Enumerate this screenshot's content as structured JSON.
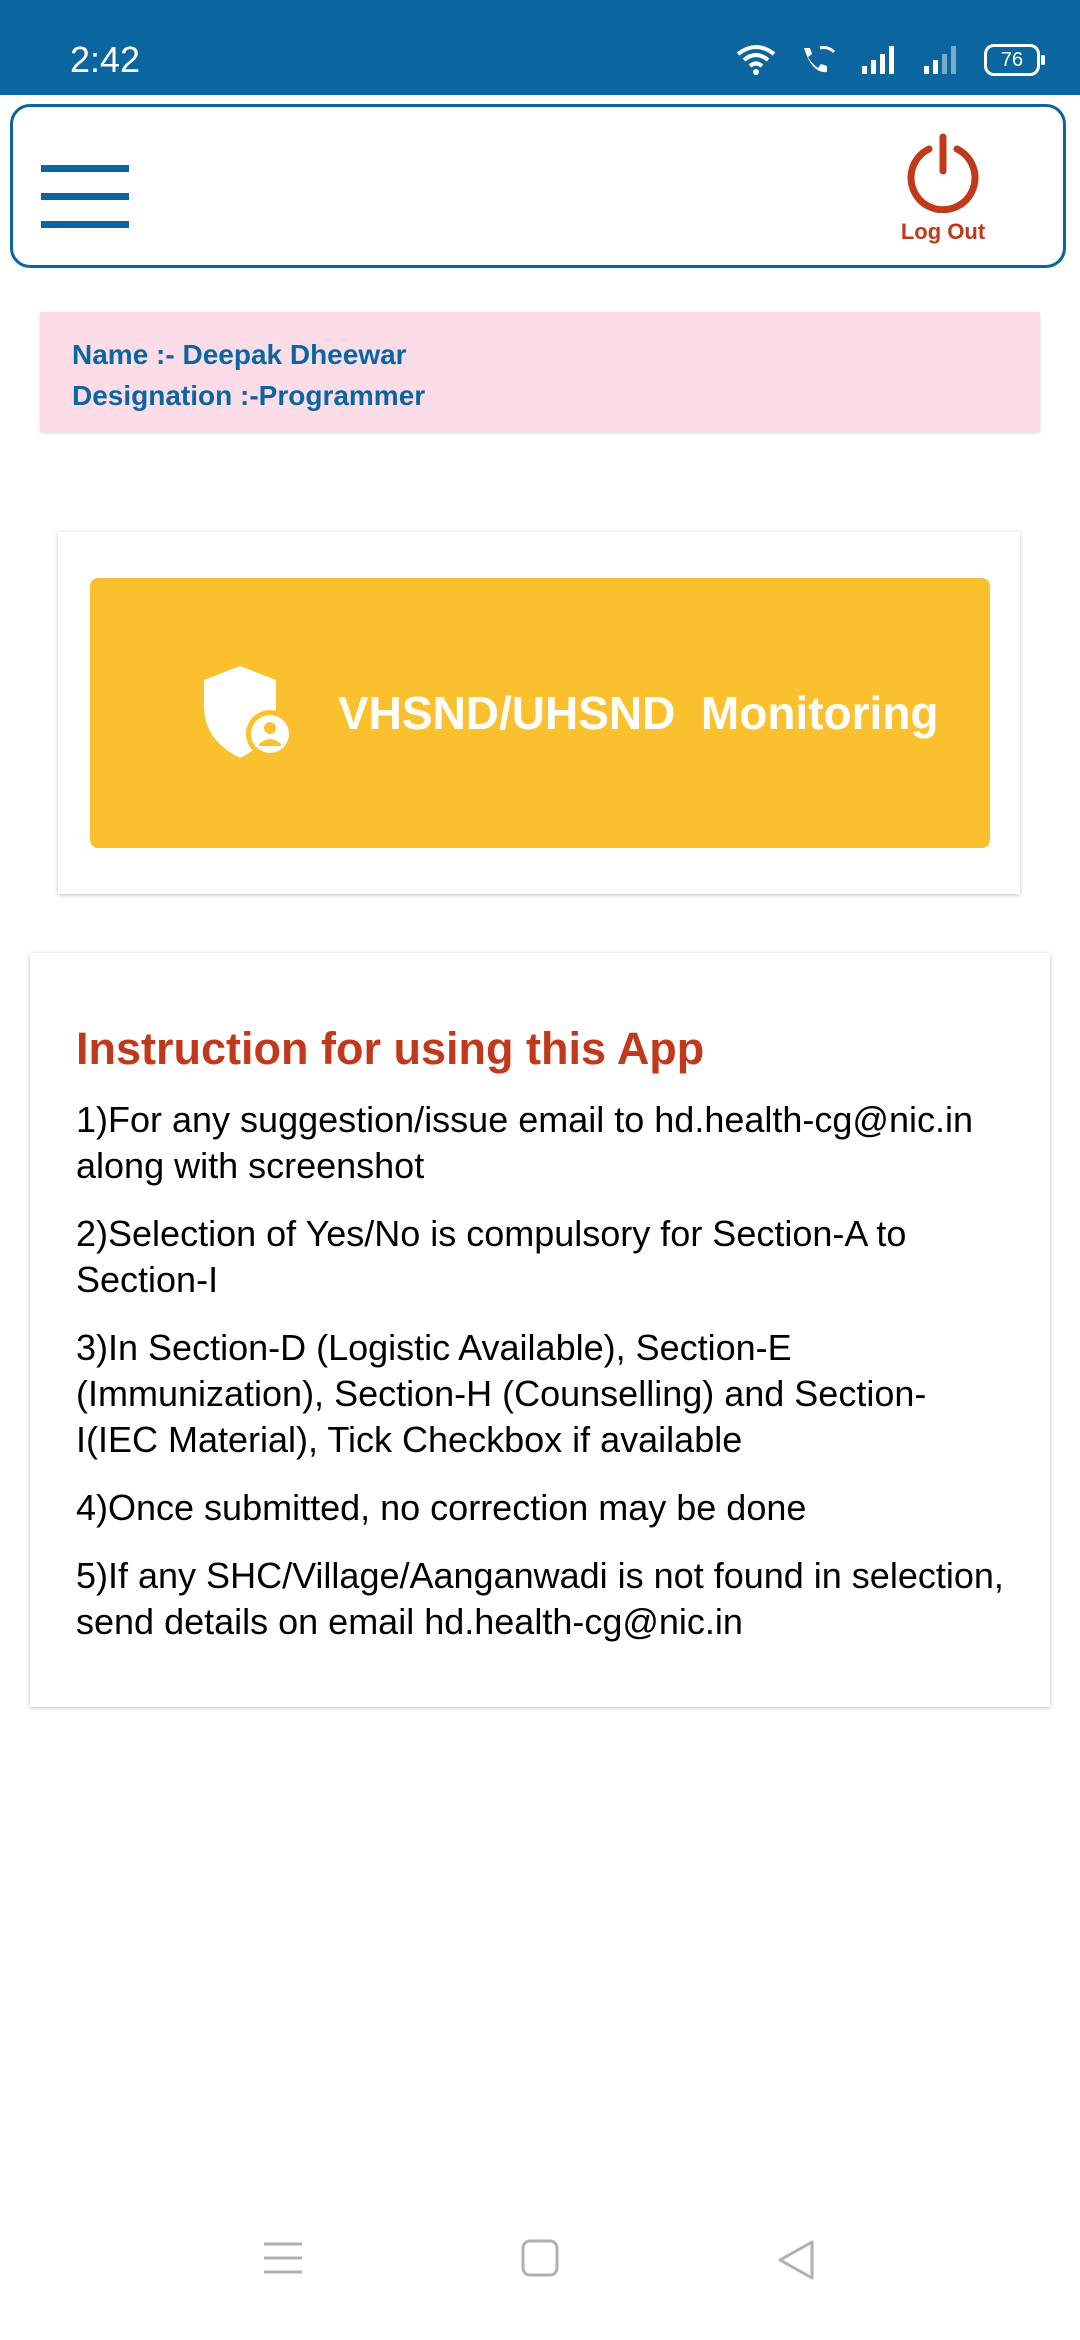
{
  "status_bar": {
    "time": "2:42",
    "battery": "76",
    "icons": [
      "wifi-icon",
      "wifi-call-icon",
      "signal-icon",
      "signal-weak-icon",
      "battery-icon"
    ]
  },
  "header": {
    "menu_icon": "hamburger-menu-icon",
    "logout_icon": "power-icon",
    "logout_label": "Log Out"
  },
  "user": {
    "name_line": "Name :- Deepak Dheewar",
    "designation_line": "Designation :-Programmer"
  },
  "monitoring_button": {
    "icon": "shield-user-icon",
    "label": "VHSND/UHSND  Monitoring"
  },
  "instructions": {
    "title": "Instruction for using this App",
    "items": [
      "1)For any suggestion/issue email to hd.health-cg@nic.in along with screenshot",
      "2)Selection of Yes/No is compulsory for Section-A to Section-I",
      "3)In Section-D (Logistic Available), Section-E (Immunization), Section-H (Counselling) and Section-I(IEC Material), Tick Checkbox if available",
      "4)Once submitted, no correction may be done",
      "5)If any SHC/Village/Aanganwadi is not found in selection, send details on email hd.health-cg@nic.in"
    ]
  },
  "nav_bar": {
    "icons": [
      "recent-apps-icon",
      "home-icon",
      "back-icon"
    ]
  },
  "colors": {
    "primary": "#0b66a0",
    "accent_red": "#c0391b",
    "button_yellow": "#fbc02d",
    "info_pink": "#fcdde7"
  }
}
